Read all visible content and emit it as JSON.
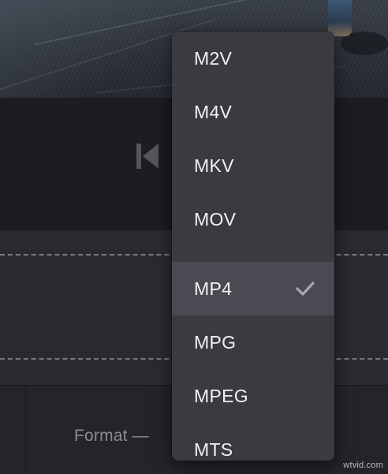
{
  "format_setting": {
    "label": "Format —"
  },
  "format_dropdown": {
    "selected": "MP4",
    "items": [
      {
        "label": "M2V",
        "selected": false
      },
      {
        "label": "M4V",
        "selected": false
      },
      {
        "label": "MKV",
        "selected": false
      },
      {
        "label": "MOV",
        "selected": false
      },
      {
        "label": "MP4",
        "selected": true
      },
      {
        "label": "MPG",
        "selected": false
      },
      {
        "label": "MPEG",
        "selected": false
      },
      {
        "label": "MTS",
        "selected": false
      }
    ]
  },
  "player": {
    "prev_icon": "skip-to-start-icon"
  },
  "watermark": "wtvid.com",
  "colors": {
    "menu_background": "#3a3a41",
    "menu_selected": "#4a4a52",
    "menu_text": "#f2f2f5",
    "check": "#a8a8ae"
  }
}
